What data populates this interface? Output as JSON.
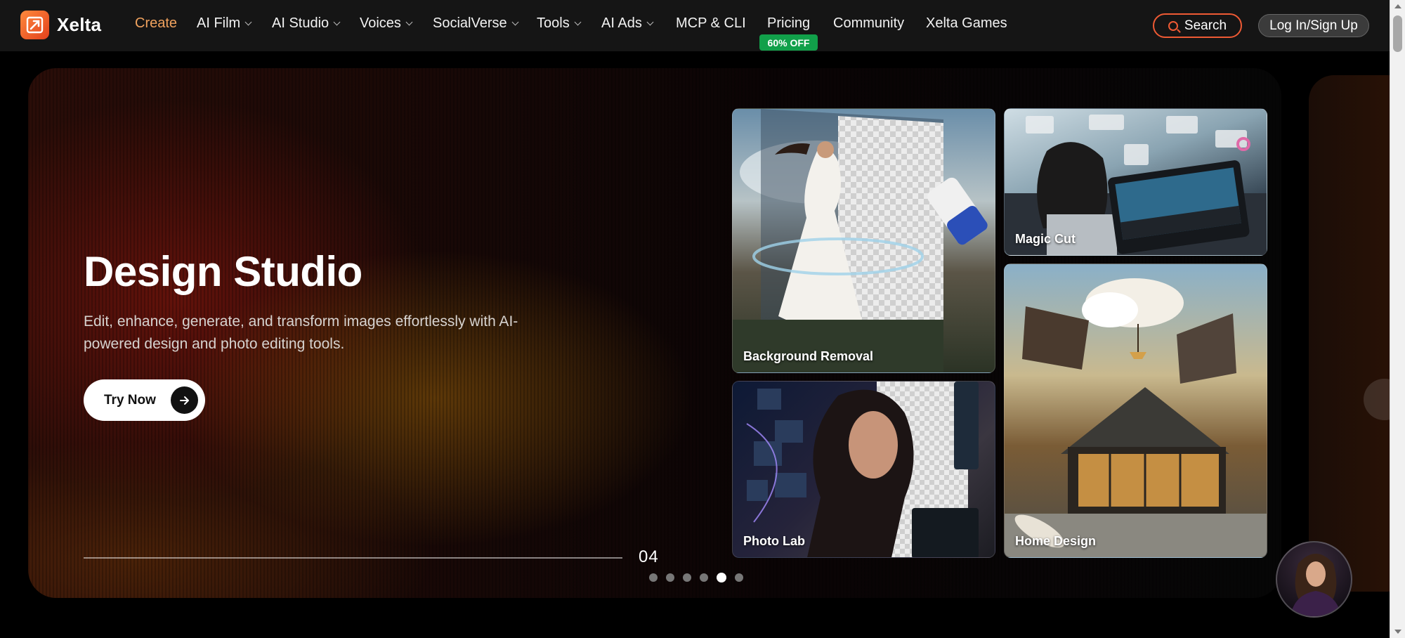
{
  "brand": {
    "name": "Xelta"
  },
  "nav": {
    "items": [
      {
        "label": "Create",
        "dropdown": false,
        "active": true
      },
      {
        "label": "AI Film",
        "dropdown": true
      },
      {
        "label": "AI Studio",
        "dropdown": true
      },
      {
        "label": "Voices",
        "dropdown": true
      },
      {
        "label": "SocialVerse",
        "dropdown": true
      },
      {
        "label": "Tools",
        "dropdown": true
      },
      {
        "label": "AI Ads",
        "dropdown": true
      },
      {
        "label": "MCP & CLI",
        "dropdown": false
      },
      {
        "label": "Pricing",
        "dropdown": false
      },
      {
        "label": "Community",
        "dropdown": false
      },
      {
        "label": "Xelta Games",
        "dropdown": false
      }
    ],
    "pricing_badge": "60% OFF",
    "search_label": "Search",
    "login_label": "Log In/Sign Up"
  },
  "hero": {
    "title": "Design Studio",
    "description": "Edit, enhance, generate, and transform images effortlessly with AI-powered design and photo editing tools.",
    "cta_label": "Try Now",
    "slide_number": "04",
    "slide_count": 6,
    "active_slide_index": 4
  },
  "tiles": [
    {
      "label": "Background Removal"
    },
    {
      "label": "Magic Cut"
    },
    {
      "label": "Photo Lab"
    },
    {
      "label": "Home Design"
    }
  ],
  "colors": {
    "accent_orange": "#ee5a34",
    "active_nav": "#f0a25e",
    "badge_green": "#11a04a"
  },
  "icons": [
    "logo-icon",
    "chevron-down-icon",
    "search-icon",
    "arrow-right-icon"
  ]
}
